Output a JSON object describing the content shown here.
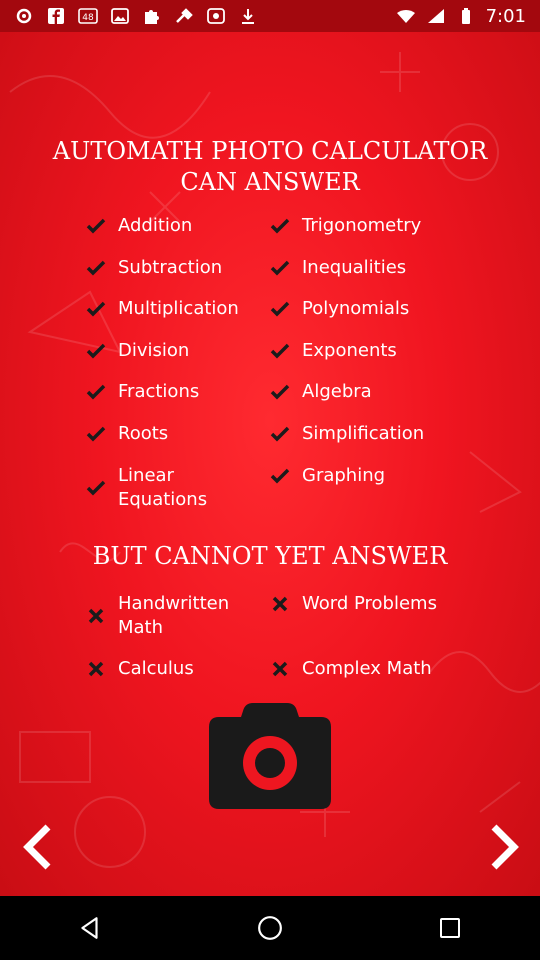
{
  "status_bar": {
    "time": "7:01",
    "icons": [
      "settings-icon",
      "facebook-icon",
      "48-badge-icon",
      "image-icon",
      "puzzle-icon",
      "tools-icon",
      "photo-icon",
      "download-icon"
    ]
  },
  "screen": {
    "title": "AUTOMATH PHOTO CALCULATOR\nCAN ANSWER",
    "can_answer_left": [
      "Addition",
      "Subtraction",
      "Multiplication",
      "Division",
      "Fractions",
      "Roots",
      "Linear\nEquations"
    ],
    "can_answer_right": [
      "Trigonometry",
      "Inequalities",
      "Polynomials",
      "Exponents",
      "Algebra",
      "Simplification",
      "Graphing"
    ],
    "cannot_title": "BUT CANNOT YET ANSWER",
    "cannot_left": [
      "Handwritten\nMath",
      "Calculus"
    ],
    "cannot_right": [
      "Word Problems",
      "Complex Math"
    ]
  },
  "colors": {
    "background": "#f01520",
    "status_bar": "#a3080e",
    "text": "#ffffff",
    "camera": "#1a1a1a"
  },
  "nav": {
    "back": "back-triangle-icon",
    "home": "home-circle-icon",
    "recents": "recents-square-icon"
  }
}
